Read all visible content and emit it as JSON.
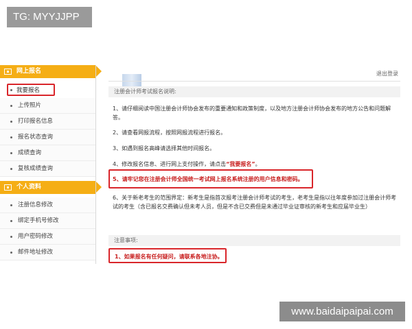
{
  "watermark_tg": "TG: MYYJJPP",
  "watermark_site": "www.baidaipaipai.com",
  "sidebar": {
    "section1_title": "网上报名",
    "section1_items": [
      "我要报名",
      "上传照片",
      "打印报名信息",
      "报名状态查询",
      "成绩查询",
      "复核成绩查询"
    ],
    "section2_title": "个人资料",
    "section2_items": [
      "注册信息修改",
      "绑定手机号修改",
      "用户密码修改",
      "邮件地址修改"
    ]
  },
  "header": {
    "logout": "退出登录"
  },
  "main": {
    "title": "注册会计师考试报名说明:",
    "item1": "1、请仔细阅读中国注册会计师协会发布的重要通知和政策制度，以及地方注册会计师协会发布的地方公告和问题解答。",
    "item2": "2、请查看网报流程，按照网报流程进行报名。",
    "item3": "3、如遇到报名高峰请选择其他时间报名。",
    "item4_prefix": "4、修改报名信息、进行网上支付操作，请点击",
    "item4_link": "“我要报名”",
    "item4_suffix": "。",
    "item5": "5、请牢记您在注册会计师全国统一考试网上报名系统注册的用户信息和密码。",
    "item6": "6、关于新老考生的范围界定：新考生是指首次报考注册会计师考试的考生，老考生是指以往年度参加过注册会计师考试的考生（含已报名交费确认但未考人员，但是不含已交费但是未通过毕业证审核的新考生和应届毕业生）",
    "notes_title": "注意事项:",
    "note1": "1、如果报名有任何疑问，请联系各地注协。"
  },
  "colors": {
    "accent": "#f5ae15",
    "alert": "#d9252a"
  }
}
